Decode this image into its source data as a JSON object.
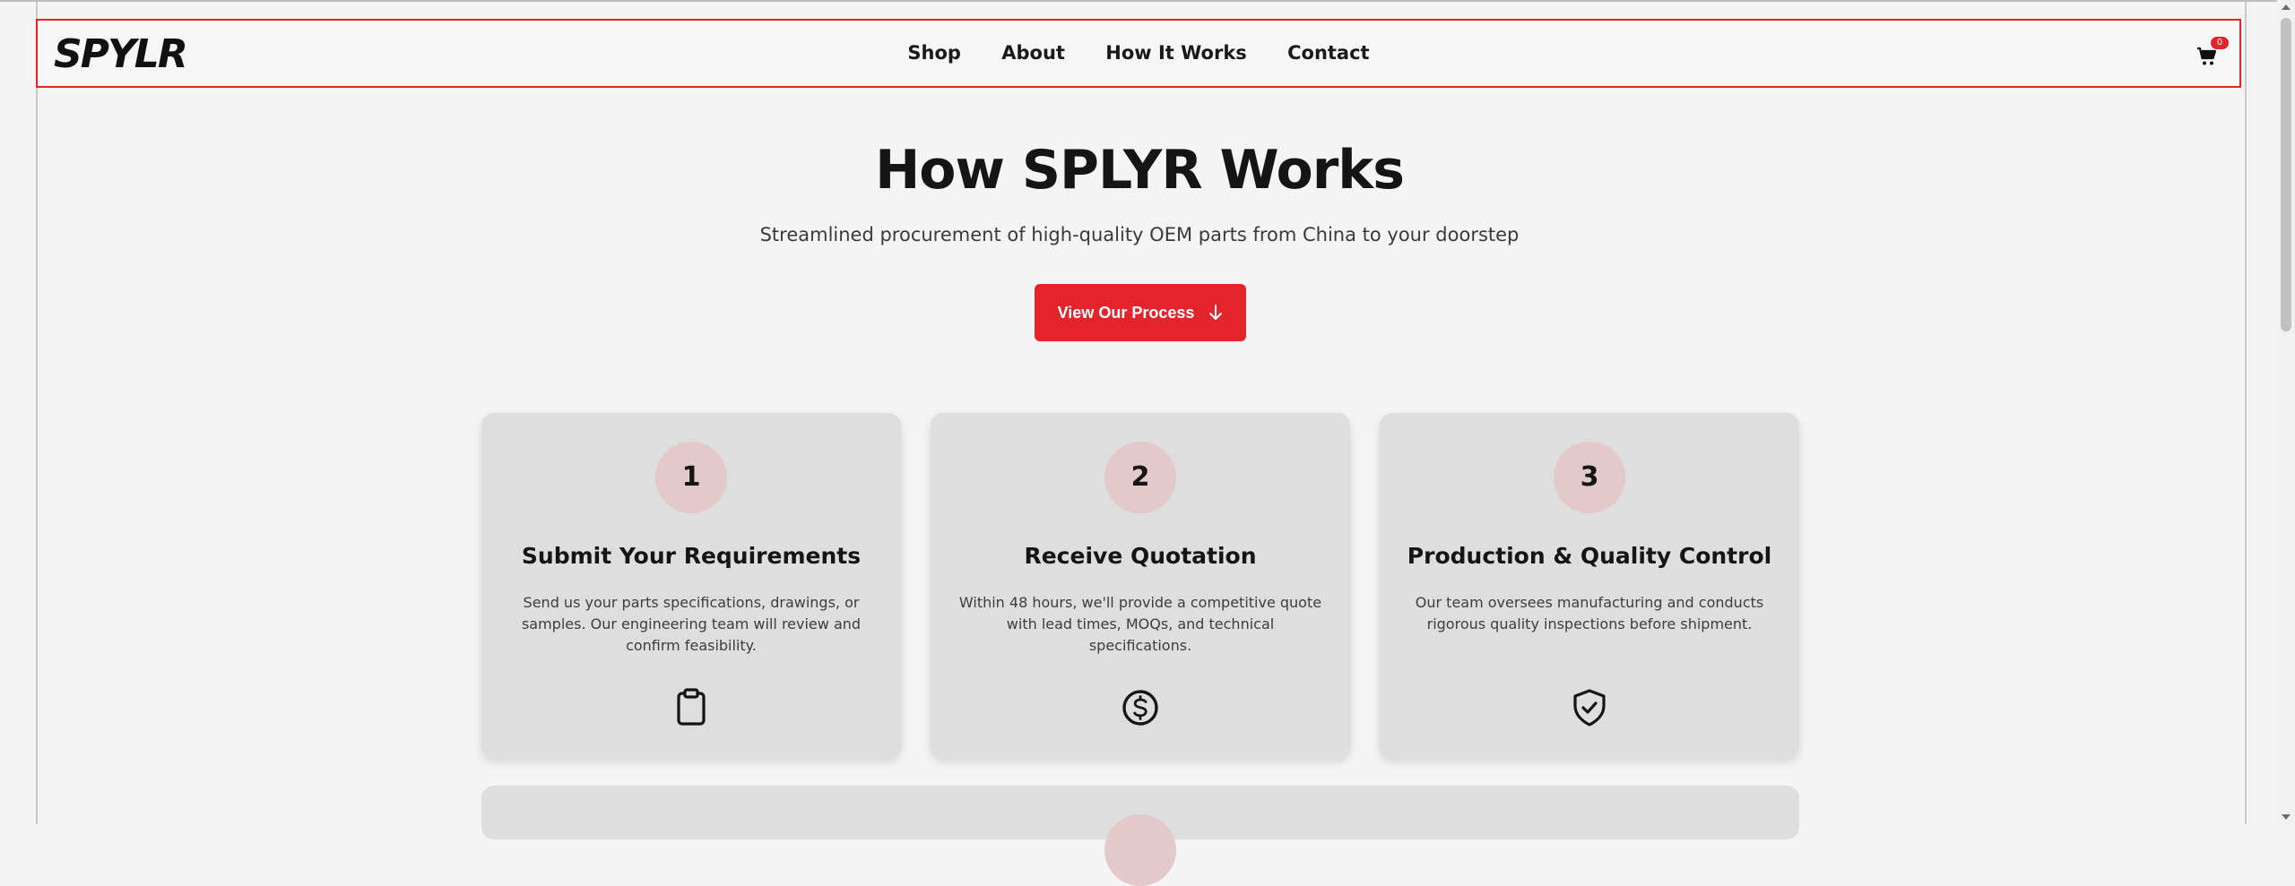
{
  "header": {
    "logo": "SPYLR",
    "nav": [
      "Shop",
      "About",
      "How It Works",
      "Contact"
    ],
    "cart_count": "0"
  },
  "hero": {
    "title": "How SPLYR Works",
    "subtitle": "Streamlined procurement of high-quality OEM parts from China to your doorstep",
    "cta_label": "View Our Process"
  },
  "steps": [
    {
      "number": "1",
      "title": "Submit Your Requirements",
      "description": "Send us your parts specifications, drawings, or samples. Our engineering team will review and confirm feasibility.",
      "icon": "clipboard-icon"
    },
    {
      "number": "2",
      "title": "Receive Quotation",
      "description": "Within 48 hours, we'll provide a competitive quote with lead times, MOQs, and technical specifications.",
      "icon": "dollar-circle-icon"
    },
    {
      "number": "3",
      "title": "Production & Quality Control",
      "description": "Our team oversees manufacturing and conducts rigorous quality inspections before shipment.",
      "icon": "shield-check-icon"
    }
  ],
  "colors": {
    "accent": "#e3242b",
    "card_bg": "#dedede",
    "number_circle": "#e3c9c9",
    "page_bg": "#f4f4f4"
  }
}
